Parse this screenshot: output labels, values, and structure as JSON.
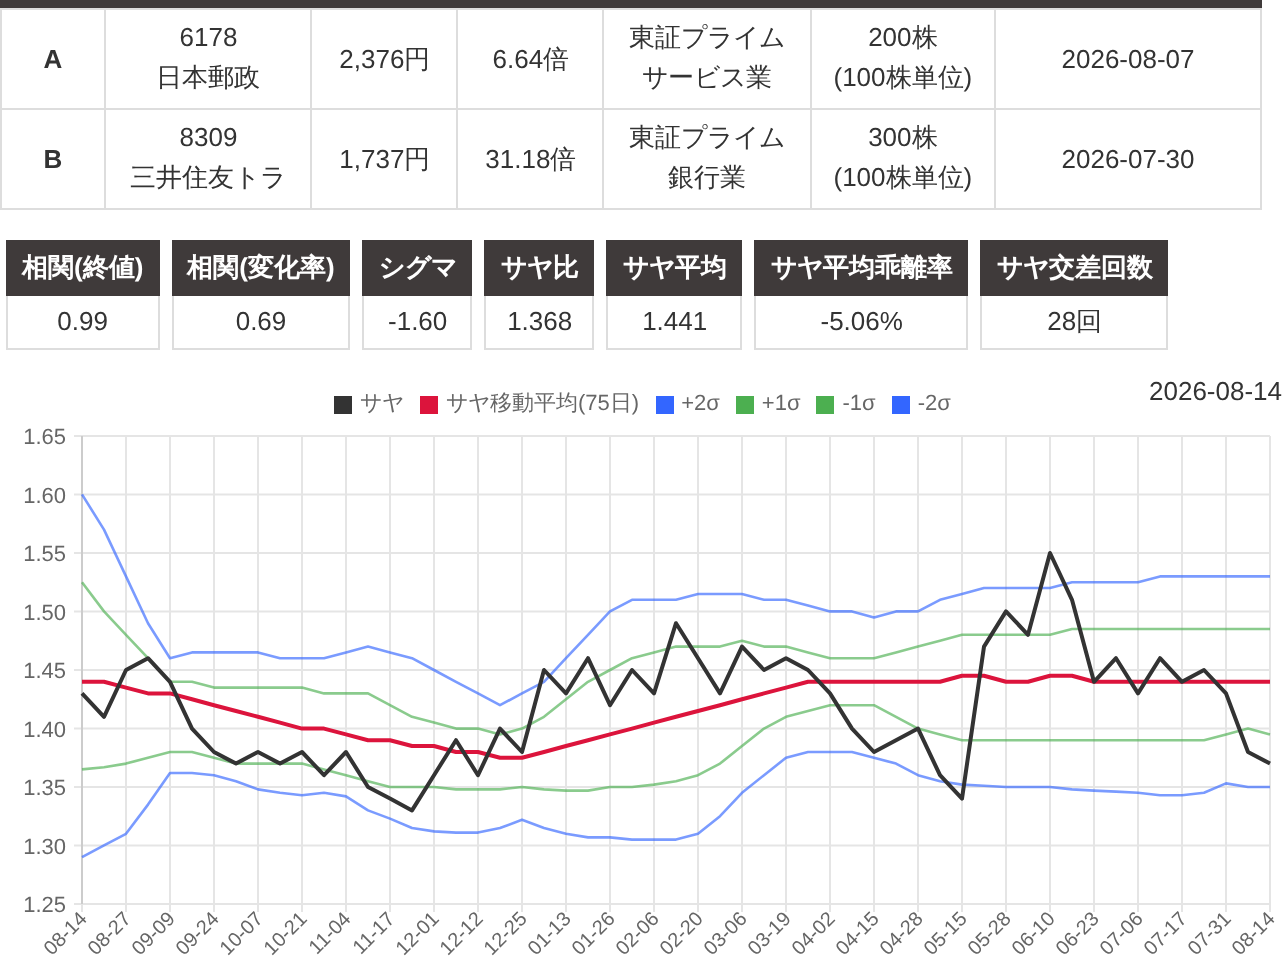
{
  "stocks": [
    {
      "label": "A",
      "code": "6178",
      "name": "日本郵政",
      "price": "2,376円",
      "per": "6.64倍",
      "market": "東証プライム",
      "sector": "サービス業",
      "shares": "200株",
      "unit": "(100株単位)",
      "date": "2026-08-07"
    },
    {
      "label": "B",
      "code": "8309",
      "name": "三井住友トラ",
      "price": "1,737円",
      "per": "31.18倍",
      "market": "東証プライム",
      "sector": "銀行業",
      "shares": "300株",
      "unit": "(100株単位)",
      "date": "2026-07-30"
    }
  ],
  "metrics": [
    {
      "label": "相関(終値)",
      "value": "0.99"
    },
    {
      "label": "相関(変化率)",
      "value": "0.69"
    },
    {
      "label": "シグマ",
      "value": "-1.60"
    },
    {
      "label": "サヤ比",
      "value": "1.368"
    },
    {
      "label": "サヤ平均",
      "value": "1.441"
    },
    {
      "label": "サヤ平均乖離率",
      "value": "-5.06%"
    },
    {
      "label": "サヤ交差回数",
      "value": "28回"
    }
  ],
  "chart": {
    "date": "2026-08-14",
    "chart_data": {
      "type": "line",
      "grid": true,
      "categories": [
        "08-14",
        null,
        "08-27",
        null,
        "09-09",
        null,
        "09-24",
        null,
        "10-07",
        null,
        "10-21",
        null,
        "11-04",
        null,
        "11-17",
        null,
        "12-01",
        null,
        "12-12",
        null,
        "12-25",
        null,
        "01-13",
        null,
        "01-26",
        null,
        "02-06",
        null,
        "02-20",
        null,
        "03-06",
        null,
        "03-19",
        null,
        "04-02",
        null,
        "04-15",
        null,
        "04-28",
        null,
        "05-15",
        null,
        "05-28",
        null,
        "06-10",
        null,
        "06-23",
        null,
        "07-06",
        null,
        "07-17",
        null,
        "07-31",
        null,
        "08-14"
      ],
      "ylim": [
        1.25,
        1.65
      ],
      "yticks": [
        {
          "value": 1.25,
          "label": "1.25"
        },
        {
          "value": 1.3,
          "label": "1.30"
        },
        {
          "value": 1.35,
          "label": "1.35"
        },
        {
          "value": 1.4,
          "label": "1.40"
        },
        {
          "value": 1.45,
          "label": "1.45"
        },
        {
          "value": 1.5,
          "label": "1.50"
        },
        {
          "value": 1.55,
          "label": "1.55"
        },
        {
          "value": 1.6,
          "label": "1.60"
        },
        {
          "value": 1.65,
          "label": "1.65"
        }
      ],
      "series": [
        {
          "name": "サヤ",
          "color": "#333333",
          "values": [
            1.43,
            1.41,
            1.45,
            1.46,
            1.44,
            1.4,
            1.38,
            1.37,
            1.38,
            1.37,
            1.38,
            1.36,
            1.38,
            1.35,
            1.34,
            1.33,
            1.36,
            1.39,
            1.36,
            1.4,
            1.38,
            1.45,
            1.43,
            1.46,
            1.42,
            1.45,
            1.43,
            1.49,
            1.46,
            1.43,
            1.47,
            1.45,
            1.46,
            1.45,
            1.43,
            1.4,
            1.38,
            1.39,
            1.4,
            1.36,
            1.34,
            1.47,
            1.5,
            1.48,
            1.55,
            1.51,
            1.44,
            1.46,
            1.43,
            1.46,
            1.44,
            1.45,
            1.43,
            1.38,
            1.37
          ]
        },
        {
          "name": "サヤ移動平均(75日)",
          "color": "#dc143c",
          "values": [
            1.44,
            1.44,
            1.435,
            1.43,
            1.43,
            1.425,
            1.42,
            1.415,
            1.41,
            1.405,
            1.4,
            1.4,
            1.395,
            1.39,
            1.39,
            1.385,
            1.385,
            1.38,
            1.38,
            1.375,
            1.375,
            1.38,
            1.385,
            1.39,
            1.395,
            1.4,
            1.405,
            1.41,
            1.415,
            1.42,
            1.425,
            1.43,
            1.435,
            1.44,
            1.44,
            1.44,
            1.44,
            1.44,
            1.44,
            1.44,
            1.445,
            1.445,
            1.44,
            1.44,
            1.445,
            1.445,
            1.44,
            1.44,
            1.44,
            1.44,
            1.44,
            1.44,
            1.44,
            1.44,
            1.44
          ]
        },
        {
          "name": "+2σ",
          "color": "#3366ff",
          "values": [
            1.6,
            1.57,
            1.53,
            1.49,
            1.46,
            1.465,
            1.465,
            1.465,
            1.465,
            1.46,
            1.46,
            1.46,
            1.465,
            1.47,
            1.465,
            1.46,
            1.45,
            1.44,
            1.43,
            1.42,
            1.43,
            1.44,
            1.46,
            1.48,
            1.5,
            1.51,
            1.51,
            1.51,
            1.515,
            1.515,
            1.515,
            1.51,
            1.51,
            1.505,
            1.5,
            1.5,
            1.495,
            1.5,
            1.5,
            1.51,
            1.515,
            1.52,
            1.52,
            1.52,
            1.52,
            1.525,
            1.525,
            1.525,
            1.525,
            1.53,
            1.53,
            1.53,
            1.53,
            1.53,
            1.53
          ]
        },
        {
          "name": "+1σ",
          "color": "#4caf50",
          "values": [
            1.525,
            1.5,
            1.48,
            1.46,
            1.44,
            1.44,
            1.435,
            1.435,
            1.435,
            1.435,
            1.435,
            1.43,
            1.43,
            1.43,
            1.42,
            1.41,
            1.405,
            1.4,
            1.4,
            1.395,
            1.4,
            1.41,
            1.425,
            1.44,
            1.45,
            1.46,
            1.465,
            1.47,
            1.47,
            1.47,
            1.475,
            1.47,
            1.47,
            1.465,
            1.46,
            1.46,
            1.46,
            1.465,
            1.47,
            1.475,
            1.48,
            1.48,
            1.48,
            1.48,
            1.48,
            1.485,
            1.485,
            1.485,
            1.485,
            1.485,
            1.485,
            1.485,
            1.485,
            1.485,
            1.485
          ]
        },
        {
          "name": "-1σ",
          "color": "#4caf50",
          "values": [
            1.365,
            1.367,
            1.37,
            1.375,
            1.38,
            1.38,
            1.375,
            1.37,
            1.37,
            1.37,
            1.37,
            1.365,
            1.36,
            1.355,
            1.35,
            1.35,
            1.35,
            1.348,
            1.348,
            1.348,
            1.35,
            1.348,
            1.347,
            1.347,
            1.35,
            1.35,
            1.352,
            1.355,
            1.36,
            1.37,
            1.385,
            1.4,
            1.41,
            1.415,
            1.42,
            1.42,
            1.42,
            1.41,
            1.4,
            1.395,
            1.39,
            1.39,
            1.39,
            1.39,
            1.39,
            1.39,
            1.39,
            1.39,
            1.39,
            1.39,
            1.39,
            1.39,
            1.395,
            1.4,
            1.395
          ]
        },
        {
          "name": "-2σ",
          "color": "#3366ff",
          "values": [
            1.29,
            1.3,
            1.31,
            1.335,
            1.362,
            1.362,
            1.36,
            1.355,
            1.348,
            1.345,
            1.343,
            1.345,
            1.342,
            1.33,
            1.323,
            1.315,
            1.312,
            1.311,
            1.311,
            1.315,
            1.322,
            1.315,
            1.31,
            1.307,
            1.307,
            1.305,
            1.305,
            1.305,
            1.31,
            1.325,
            1.345,
            1.36,
            1.375,
            1.38,
            1.38,
            1.38,
            1.375,
            1.37,
            1.36,
            1.355,
            1.352,
            1.351,
            1.35,
            1.35,
            1.35,
            1.348,
            1.347,
            1.346,
            1.345,
            1.343,
            1.343,
            1.345,
            1.353,
            1.35,
            1.35
          ]
        }
      ]
    }
  }
}
